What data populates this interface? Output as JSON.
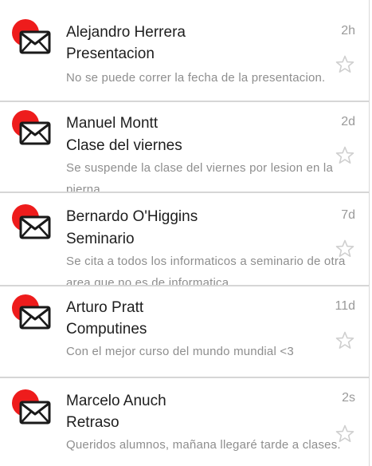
{
  "messages": [
    {
      "sender": "Alejandro Herrera",
      "subject": "Presentacion",
      "snippet": "No se puede correr la fecha de la presentacion.",
      "time": "2h",
      "starred": false
    },
    {
      "sender": "Manuel Montt",
      "subject": "Clase del viernes",
      "snippet": "Se suspende la clase del viernes por lesion en la pierna",
      "time": "2d",
      "starred": false
    },
    {
      "sender": "Bernardo O'Higgins",
      "subject": "Seminario",
      "snippet": "Se cita a todos los informaticos a seminario de otra area que no es de informatica",
      "time": "7d",
      "starred": false
    },
    {
      "sender": "Arturo Pratt",
      "subject": "Computines",
      "snippet": "Con el mejor curso del mundo mundial <3",
      "time": "11d",
      "starred": false
    },
    {
      "sender": "Marcelo Anuch",
      "subject": "Retraso",
      "snippet": "Queridos alumnos, mañana llegaré tarde a clases.",
      "time": "2s",
      "starred": false
    }
  ],
  "colors": {
    "avatar_dot": "#ee1c1c",
    "text_primary": "#1e1e1e",
    "text_secondary": "#8e8e8e",
    "star_outline": "#cfcfcf"
  },
  "icons": {
    "avatar": "envelope-icon",
    "favorite": "star-outline-icon"
  }
}
